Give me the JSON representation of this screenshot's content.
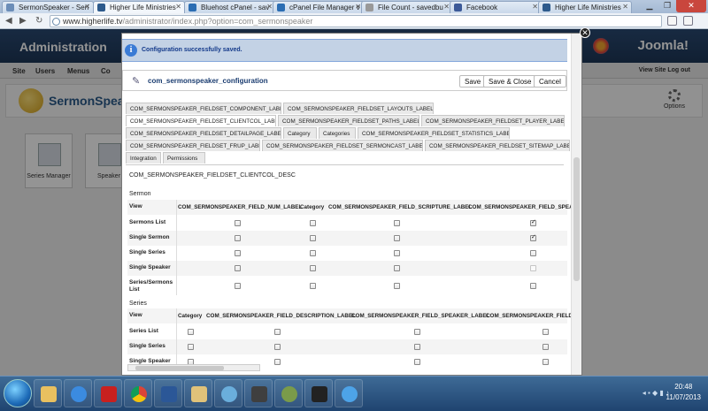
{
  "browser": {
    "tabs": [
      {
        "label": "SermonSpeaker - Seri"
      },
      {
        "label": "Higher Life Ministries"
      },
      {
        "label": "Bluehost cPanel - sav"
      },
      {
        "label": "cPanel File Manager v"
      },
      {
        "label": "File Count - savedbu"
      },
      {
        "label": "Facebook"
      },
      {
        "label": "Higher Life Ministries"
      }
    ],
    "url_prefix": "www.higherlife.tv",
    "url_path": "/administrator/index.php?option=com_sermonspeaker"
  },
  "admin": {
    "title": "Administration",
    "logo": "Joomla!",
    "menu": [
      "Site",
      "Users",
      "Menus",
      "Co"
    ],
    "right_links": "View Site   Log out",
    "component_title": "SermonSpea",
    "options_label": "Options",
    "cards": [
      "Series Manager",
      "Speaker"
    ]
  },
  "modal": {
    "message": "Configuration successfully saved.",
    "config_title": "com_sermonspeaker_configuration",
    "buttons": {
      "save": "Save",
      "save_close": "Save & Close",
      "cancel": "Cancel"
    },
    "tabs_row1": [
      "COM_SERMONSPEAKER_FIELDSET_COMPONENT_LABEL",
      "COM_SERMONSPEAKER_FIELDSET_LAYOUTS_LABEL"
    ],
    "tabs_row2": [
      "COM_SERMONSPEAKER_FIELDSET_CLIENTCOL_LABEL",
      "COM_SERMONSPEAKER_FIELDSET_PATHS_LABEL",
      "COM_SERMONSPEAKER_FIELDSET_PLAYER_LABEL"
    ],
    "tabs_row3": [
      "COM_SERMONSPEAKER_FIELDSET_DETAILPAGE_LABEL",
      "Category",
      "Categories",
      "COM_SERMONSPEAKER_FIELDSET_STATISTICS_LABEL"
    ],
    "tabs_row4": [
      "COM_SERMONSPEAKER_FIELDSET_FRUP_LABEL",
      "COM_SERMONSPEAKER_FIELDSET_SERMONCAST_LABEL",
      "COM_SERMONSPEAKER_FIELDSET_SITEMAP_LABEL"
    ],
    "tabs_row5": [
      "Integration",
      "Permissions"
    ],
    "description": "COM_SERMONSPEAKER_FIELDSET_CLIENTCOL_DESC",
    "sermon": {
      "label": "Sermon",
      "view_label": "View",
      "columns": [
        "COM_SERMONSPEAKER_FIELD_NUM_LABEL",
        "Category",
        "COM_SERMONSPEAKER_FIELD_SCRIPTURE_LABEL",
        "COM_SERMONSPEAKER_FIELD_SPEAKE"
      ],
      "rows": [
        {
          "label": "Sermons List",
          "checks": [
            false,
            false,
            false,
            true
          ]
        },
        {
          "label": "Single Sermon",
          "checks": [
            false,
            false,
            false,
            true
          ]
        },
        {
          "label": "Single Series",
          "checks": [
            false,
            false,
            false,
            false
          ]
        },
        {
          "label": "Single Speaker",
          "checks": [
            false,
            false,
            false,
            false
          ]
        },
        {
          "label": "Series/Sermons List",
          "checks": [
            false,
            false,
            false,
            false
          ]
        }
      ]
    },
    "series": {
      "label": "Series",
      "view_label": "View",
      "columns": [
        "Category",
        "COM_SERMONSPEAKER_FIELD_DESCRIPTION_LABEL",
        "COM_SERMONSPEAKER_FIELD_SPEAKER_LABEL",
        "COM_SERMONSPEAKER_FIELD_N"
      ],
      "rows": [
        {
          "label": "Series List"
        },
        {
          "label": "Single Series"
        },
        {
          "label": "Single Speaker"
        }
      ]
    }
  },
  "taskbar": {
    "tray_text": "◂ ▪ ◆ ▮ ♪",
    "time": "20:48",
    "date": "11/07/2013"
  },
  "colors": {
    "accent": "#1a3c70",
    "message_bg": "#c3d2e5",
    "admin_header": "#2a4a72"
  }
}
